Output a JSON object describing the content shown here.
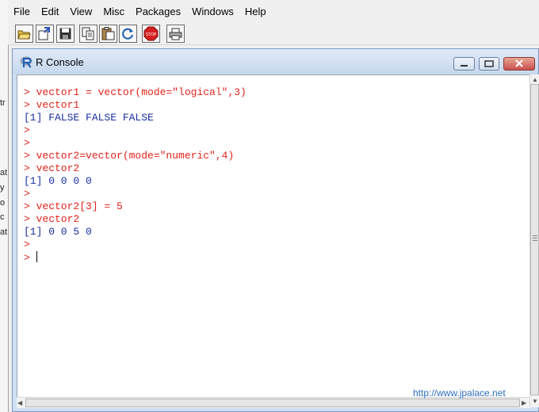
{
  "menubar": {
    "items": [
      "File",
      "Edit",
      "View",
      "Misc",
      "Packages",
      "Windows",
      "Help"
    ]
  },
  "background_fragments": [
    "tr",
    "at",
    "y",
    "o",
    "c",
    "at"
  ],
  "toolbar": {
    "buttons": [
      "open-script-icon",
      "load-workspace-icon",
      "save-icon",
      "copy-icon",
      "paste-icon",
      "refresh-icon",
      "stop-icon",
      "print-icon"
    ]
  },
  "console": {
    "title": "R Console",
    "lines": [
      {
        "kind": "in",
        "text": "> vector1 = vector(mode=\"logical\",3)"
      },
      {
        "kind": "in",
        "text": "> vector1"
      },
      {
        "kind": "out",
        "text": "[1] FALSE FALSE FALSE"
      },
      {
        "kind": "in",
        "text": ">"
      },
      {
        "kind": "in",
        "text": ">"
      },
      {
        "kind": "in",
        "text": "> vector2=vector(mode=\"numeric\",4)"
      },
      {
        "kind": "in",
        "text": "> vector2"
      },
      {
        "kind": "out",
        "text": "[1] 0 0 0 0"
      },
      {
        "kind": "in",
        "text": ">"
      },
      {
        "kind": "in",
        "text": "> vector2[3] = 5"
      },
      {
        "kind": "in",
        "text": "> vector2"
      },
      {
        "kind": "out",
        "text": "[1] 0 0 5 0"
      },
      {
        "kind": "in",
        "text": ">"
      },
      {
        "kind": "in",
        "text": "> ",
        "cursor": true
      }
    ]
  },
  "watermark": "http://www.jpalace.net",
  "colors": {
    "input": "#e2231a",
    "output": "#1a2ea0",
    "title_bar": "#c6d8ee"
  }
}
